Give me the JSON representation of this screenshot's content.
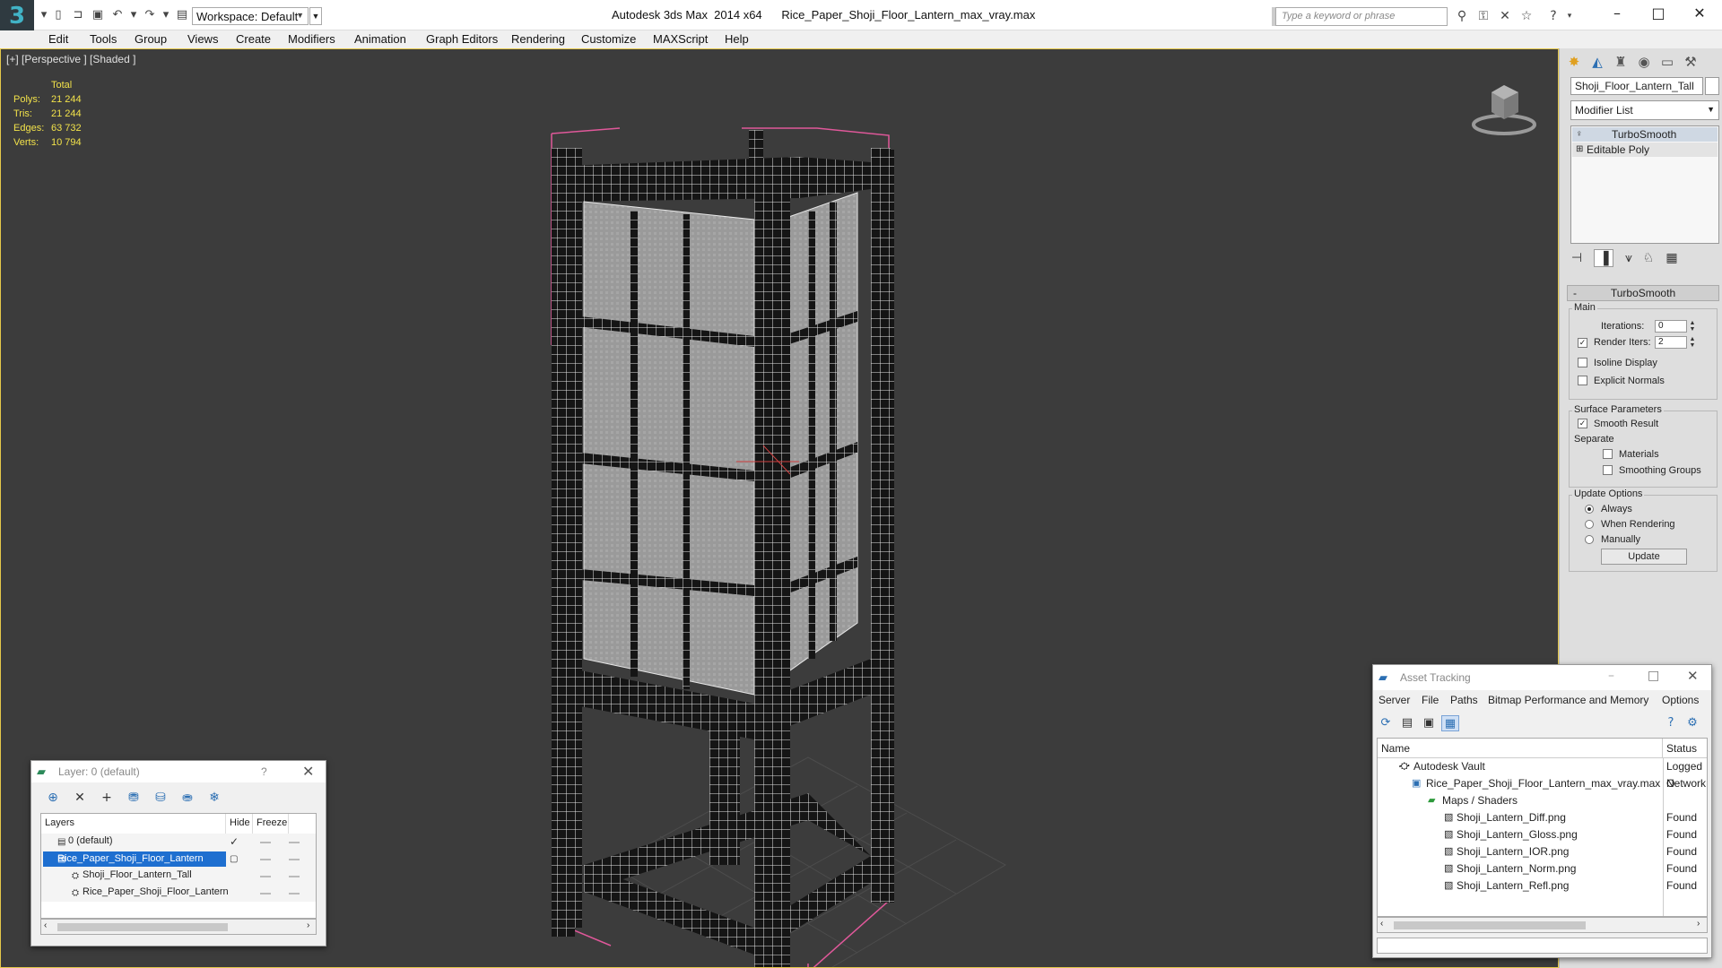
{
  "titlebar": {
    "workspace": "Workspace: Default",
    "app_title": "Autodesk 3ds Max  2014 x64",
    "file_title": "Rice_Paper_Shoji_Floor_Lantern_max_vray.max",
    "search_placeholder": "Type a keyword or phrase"
  },
  "menu": [
    "Edit",
    "Tools",
    "Group",
    "Views",
    "Create",
    "Modifiers",
    "Animation",
    "Graph Editors",
    "Rendering",
    "Customize",
    "MAXScript",
    "Help"
  ],
  "viewport": {
    "label": "[+] [Perspective ] [Shaded ]",
    "stats_header": "Total",
    "stats": [
      {
        "key": "Polys:",
        "value": "21 244"
      },
      {
        "key": "Tris:",
        "value": "21 244"
      },
      {
        "key": "Edges:",
        "value": "63 732"
      },
      {
        "key": "Verts:",
        "value": "10 794"
      }
    ]
  },
  "command_panel": {
    "object_name": "Shoji_Floor_Lantern_Tall",
    "modifier_list": "Modifier List",
    "stack": [
      "TurboSmooth",
      "Editable Poly"
    ],
    "rollout_title": "TurboSmooth",
    "main_group": "Main",
    "iterations_label": "Iterations:",
    "iterations_value": "0",
    "render_iters_label": "Render Iters:",
    "render_iters_value": "2",
    "render_iters_checked": true,
    "isoline_label": "Isoline Display",
    "isoline_checked": false,
    "explicit_normals_label": "Explicit Normals",
    "explicit_normals_checked": false,
    "surface_group": "Surface Parameters",
    "smooth_result_label": "Smooth Result",
    "smooth_result_checked": true,
    "separate_label": "Separate",
    "materials_label": "Materials",
    "smoothing_groups_label": "Smoothing Groups",
    "update_group": "Update Options",
    "update_options": [
      "Always",
      "When Rendering",
      "Manually"
    ],
    "update_selected": "Always",
    "update_button": "Update"
  },
  "layer_dialog": {
    "title": "Layer: 0 (default)",
    "help": "?",
    "columns": [
      "Layers",
      "Hide",
      "Freeze"
    ],
    "rows": [
      {
        "name": "0 (default)",
        "indent": 1,
        "selected": false,
        "active": true
      },
      {
        "name": "Rice_Paper_Shoji_Floor_Lantern",
        "indent": 1,
        "selected": true,
        "active": false
      },
      {
        "name": "Shoji_Floor_Lantern_Tall",
        "indent": 2,
        "selected": false,
        "active": false
      },
      {
        "name": "Rice_Paper_Shoji_Floor_Lantern",
        "indent": 2,
        "selected": false,
        "active": false
      }
    ]
  },
  "asset_tracking": {
    "title": "Asset Tracking",
    "menu": [
      "Server",
      "File",
      "Paths",
      "Bitmap Performance and Memory",
      "Options"
    ],
    "columns": [
      "Name",
      "Status"
    ],
    "rows": [
      {
        "name": "Autodesk Vault",
        "status": "Logged O",
        "indent": 1,
        "icon": "vault-icon"
      },
      {
        "name": "Rice_Paper_Shoji_Floor_Lantern_max_vray.max",
        "status": "Network",
        "indent": 2,
        "icon": "max-file-icon"
      },
      {
        "name": "Maps / Shaders",
        "status": "",
        "indent": 3,
        "icon": "folder-icon"
      },
      {
        "name": "Shoji_Lantern_Diff.png",
        "status": "Found",
        "indent": 4,
        "icon": "image-file-icon"
      },
      {
        "name": "Shoji_Lantern_Gloss.png",
        "status": "Found",
        "indent": 4,
        "icon": "image-file-icon"
      },
      {
        "name": "Shoji_Lantern_IOR.png",
        "status": "Found",
        "indent": 4,
        "icon": "image-file-icon"
      },
      {
        "name": "Shoji_Lantern_Norm.png",
        "status": "Found",
        "indent": 4,
        "icon": "image-file-icon"
      },
      {
        "name": "Shoji_Lantern_Refl.png",
        "status": "Found",
        "indent": 4,
        "icon": "image-file-icon"
      }
    ]
  },
  "colors": {
    "viewport_bg": "#3c3c3c",
    "stats_yellow": "#f2e24a",
    "selection_blue": "#1e6fd0",
    "viewport_border": "#e5c84a",
    "wireframe": "#ffffff",
    "bounding_box": "#e0589a"
  }
}
